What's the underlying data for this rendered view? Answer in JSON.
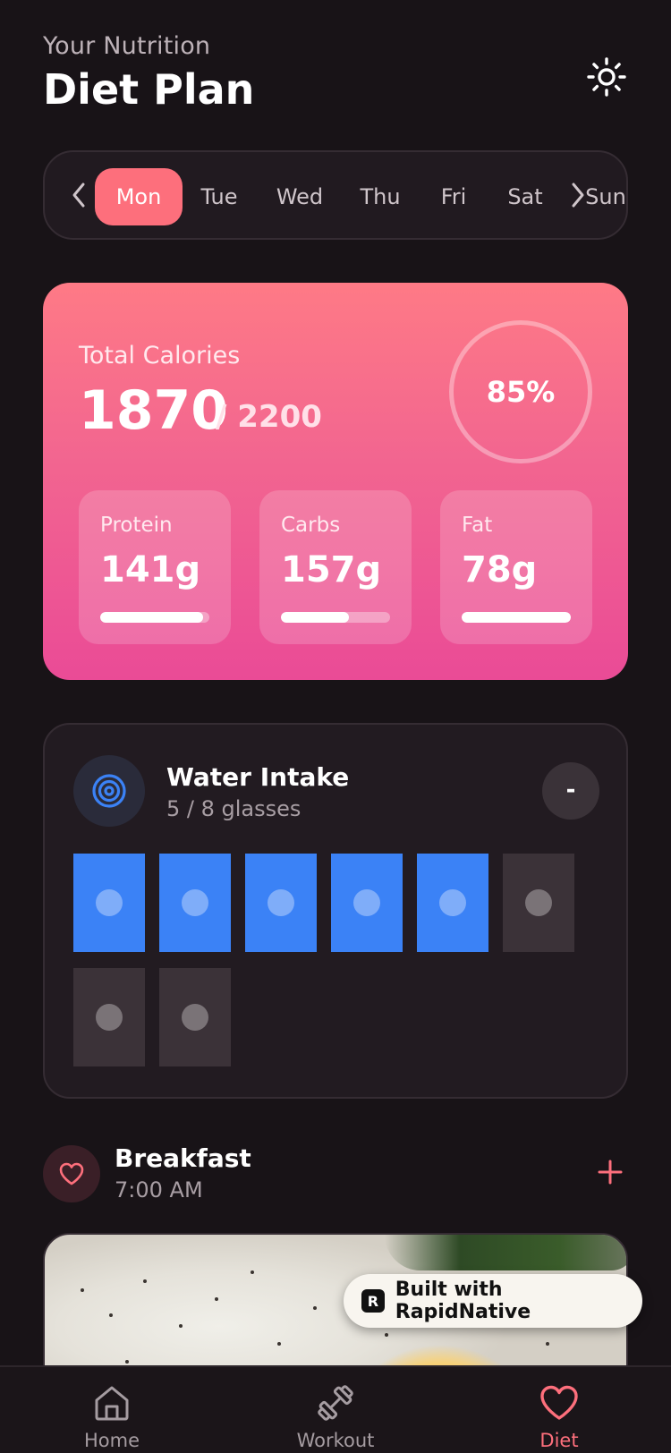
{
  "header": {
    "subtitle": "Your Nutrition",
    "title": "Diet Plan",
    "theme_icon": "sun-icon"
  },
  "days": {
    "items": [
      "Mon",
      "Tue",
      "Wed",
      "Thu",
      "Fri",
      "Sat",
      "Sun"
    ],
    "selected": "Mon",
    "prev_icon": "chevron-left-icon",
    "next_icon": "chevron-right-icon"
  },
  "calories": {
    "label": "Total Calories",
    "value": "1870",
    "goal": "/ 2200",
    "percent": "85%",
    "macros": [
      {
        "label": "Protein",
        "value": "141g",
        "progress": 0.94
      },
      {
        "label": "Carbs",
        "value": "157g",
        "progress": 0.62
      },
      {
        "label": "Fat",
        "value": "78g",
        "progress": 1.0
      }
    ]
  },
  "water": {
    "title": "Water Intake",
    "subtitle": "5 / 8 glasses",
    "minus_label": "-",
    "filled": 5,
    "total": 8
  },
  "meal": {
    "title": "Breakfast",
    "time": "7:00 AM",
    "icon": "heart-icon",
    "add_icon": "plus-icon"
  },
  "badge": {
    "text": "Built with RapidNative",
    "logo": "R"
  },
  "tabs": [
    {
      "label": "Home",
      "icon": "home-icon",
      "active": false
    },
    {
      "label": "Workout",
      "icon": "dumbbell-icon",
      "active": false
    },
    {
      "label": "Diet",
      "icon": "heart-icon",
      "active": true
    }
  ],
  "colors": {
    "accent": "#fd6f7c",
    "water": "#3b82f6",
    "background": "#181317"
  }
}
